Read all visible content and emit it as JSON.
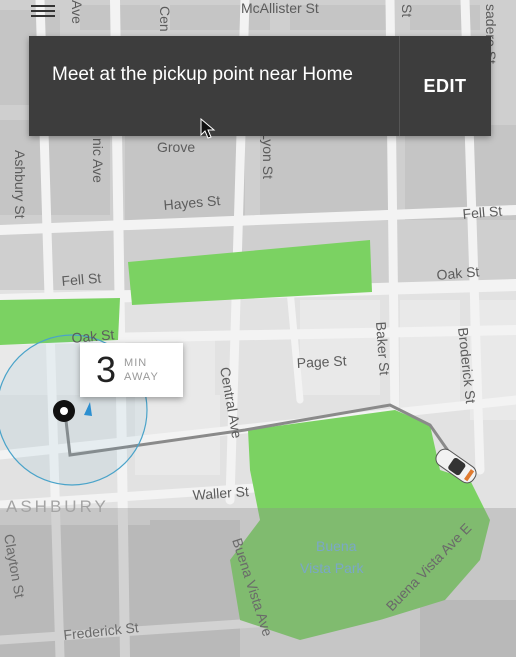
{
  "pickup": {
    "message": "Meet at the pickup point near Home",
    "edit_label": "EDIT"
  },
  "eta": {
    "minutes": "3",
    "unit_line1": "MIN",
    "unit_line2": "AWAY"
  },
  "map": {
    "streets": {
      "mcallister": "McAllister St",
      "ave_top": "Ave",
      "cen_top": "Cen",
      "st_top": "St",
      "divisadero": "sadero St",
      "grove": "Grove",
      "masonic": "nic Ave",
      "lyon": "Lyon St",
      "ashbury": "Ashbury St",
      "hayes": "Hayes St",
      "fell_right": "Fell St",
      "fell_left": "Fell St",
      "oak_right": "Oak St",
      "oak_left": "Oak St",
      "page": "Page St",
      "central": "Central Ave",
      "baker": "Baker St",
      "broderick": "Broderick St",
      "waller": "Waller St",
      "clayton": "Clayton St",
      "buena_vista_ave_left": "Buena Vista Ave",
      "buena_vista_ave_right": "Buena Vista Ave E",
      "frederick": "Frederick St"
    },
    "park_label_line1": "Buena",
    "park_label_line2": "Vista Park",
    "neighborhood": "ASHBURY"
  },
  "colors": {
    "park": "#7bd262",
    "route": "#8a8a8a",
    "banner_bg": "#3d3d3d",
    "pickup_radius": "#4aa3c9",
    "car": "#f2f2f2"
  }
}
